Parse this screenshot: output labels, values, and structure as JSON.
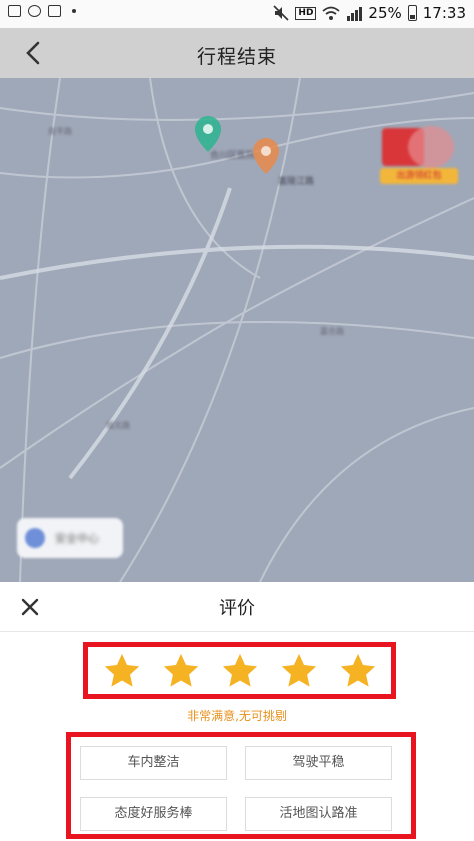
{
  "status_bar": {
    "battery": "25%",
    "time": "17:33",
    "network_badge": "HD"
  },
  "header": {
    "title": "行程结束",
    "back_icon": "chevron-left-icon"
  },
  "map": {
    "labels": {
      "start_pin": "合川区医院",
      "end_pin": "嘉陵江路",
      "road_1": "南平路",
      "road_2": "嘉合路",
      "road_3": "城北路"
    },
    "safety_center": "安全中心",
    "promo_badge": "出游领红包"
  },
  "rating_sheet": {
    "title": "评价",
    "close_icon": "close-icon",
    "stars": [
      {
        "filled": true
      },
      {
        "filled": true
      },
      {
        "filled": true
      },
      {
        "filled": true
      },
      {
        "filled": true
      }
    ],
    "rating_level": 5,
    "rating_text": "非常满意,无可挑剔",
    "star_color": "#f5b324",
    "highlight_color": "#e8141f",
    "tags": [
      "车内整洁",
      "驾驶平稳",
      "态度好服务棒",
      "活地图认路准"
    ]
  }
}
